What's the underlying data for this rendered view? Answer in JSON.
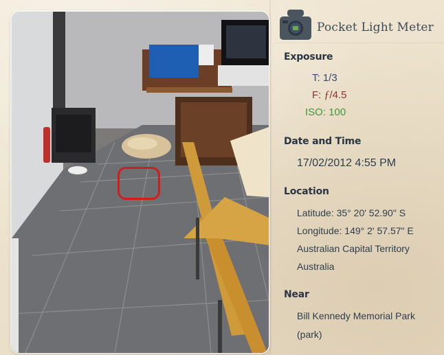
{
  "app": {
    "title": "Pocket Light Meter"
  },
  "exposure": {
    "heading": "Exposure",
    "shutter": "T: 1/3",
    "aperture_prefix": "F: ",
    "aperture_symbol": "ƒ",
    "aperture_value": "/4.5",
    "iso": "ISO: 100"
  },
  "datetime": {
    "heading": "Date and Time",
    "value": "17/02/2012 4:55 PM"
  },
  "location": {
    "heading": "Location",
    "latitude": "Latitude: 35° 20' 52.90\" S",
    "longitude": "Longitude: 149° 2' 57.57\" E",
    "region": "Australian Capital Territory",
    "country": "Australia"
  },
  "near": {
    "heading": "Near",
    "line1": "Bill Kennedy Memorial Park",
    "line2": "(park)"
  },
  "colors": {
    "focus_box": "#d21d1d",
    "aperture_text": "#8b3333",
    "iso_text": "#3c9a3c",
    "heading_text": "#2b3442"
  },
  "icons": {
    "app_logo": "camera-icon",
    "focus": "focus-box"
  }
}
